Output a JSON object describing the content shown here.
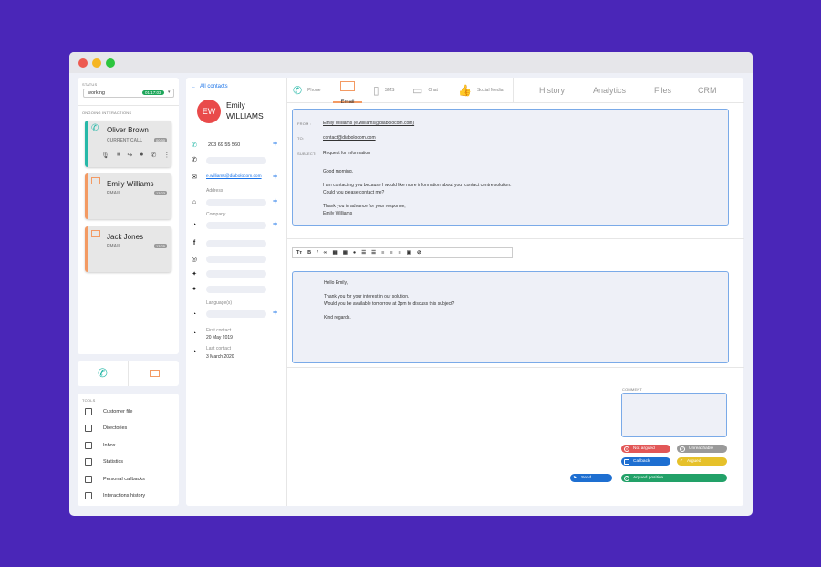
{
  "window": {
    "dots": [
      "#ed5a50",
      "#f5b522",
      "#2cc53e"
    ]
  },
  "status": {
    "label": "STATUS",
    "value": "working",
    "timer": "01:17:03"
  },
  "ongoing": {
    "label": "ONGOING INTERACTIONS",
    "items": [
      {
        "name": "Oliver Brown",
        "sub": "CURRENT CALL",
        "time": "00:30",
        "type": "call",
        "color": "#27b8a8"
      },
      {
        "name": "Emily Williams",
        "sub": "EMAIL",
        "time": "13:23",
        "type": "email",
        "color": "#f39a63"
      },
      {
        "name": "Jack Jones",
        "sub": "EMAIL",
        "time": "13:25",
        "type": "email",
        "color": "#f39a63"
      }
    ]
  },
  "tools": {
    "label": "TOOLS",
    "items": [
      "Customer file",
      "Directories",
      "Inbox",
      "Statistics",
      "Personal callbacks",
      "Interactions history"
    ]
  },
  "contact": {
    "back": "All contacts",
    "initials": "EW",
    "first": "Emily",
    "last": "WILLIAMS",
    "phone": "203 69 55 560",
    "email": "e.williams@diabolocom.com",
    "address_label": "Address",
    "company_label": "Company",
    "language_label": "Language(s)",
    "first_contact_label": "First contact",
    "first_contact": "20 May 2019",
    "last_contact_label": "Last contact",
    "last_contact": "3 March 2020"
  },
  "channels": [
    {
      "label": "Phone"
    },
    {
      "label": "Email"
    },
    {
      "label": "SMS"
    },
    {
      "label": "Chat"
    },
    {
      "label": "Social Media"
    }
  ],
  "right_tabs": [
    "History",
    "Analytics",
    "Files",
    "CRM"
  ],
  "email": {
    "from_label": "FROM :",
    "from": "Emily Williams (e.williams@diabolocom.com)",
    "to_label": "TO:",
    "to": "contact@diabolocom.com",
    "subject_label": "SUBJECT:",
    "subject": "Request for information",
    "body": [
      "Good morning,",
      "I am contacting you because I would like more information about your contact centre solution.",
      "Could you please contact me?",
      "Thank you in advance for your response,",
      "Emily Williams"
    ]
  },
  "reply": {
    "lines": [
      "Hello Emily,",
      "Thank you for your interest in our solution.",
      "Would you be available tomorrow at 3pm to discuss this subject?",
      "Kind regards."
    ]
  },
  "comment_label": "COMMENT",
  "qualif": {
    "not_argued": "Not argued",
    "unreachable": "Unreachable",
    "callback": "Callback",
    "argued": "Argued",
    "argued_positive": "Argued positive",
    "send": "Send"
  }
}
